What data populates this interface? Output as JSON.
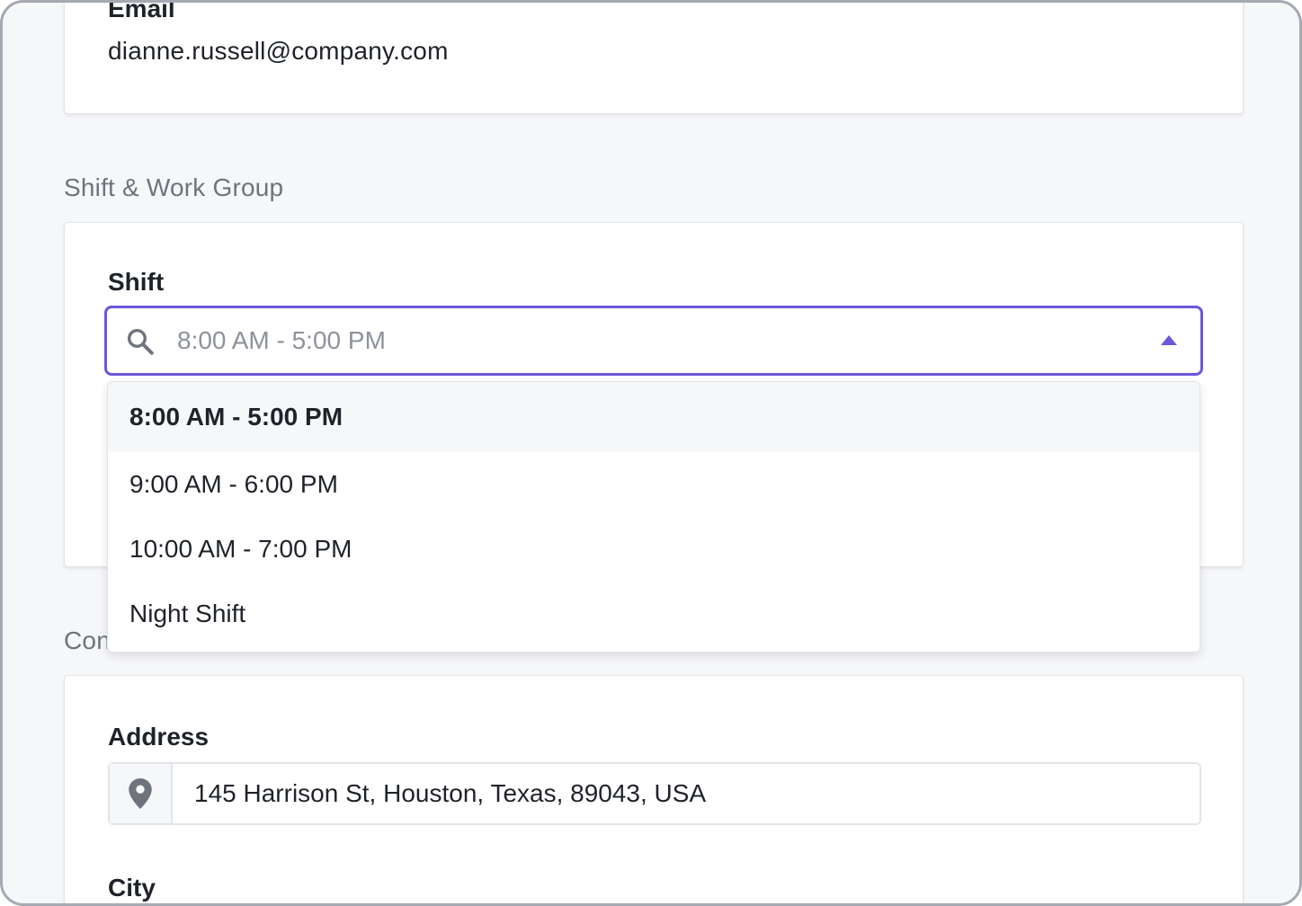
{
  "email": {
    "label": "Email",
    "value": "dianne.russell@company.com"
  },
  "shift_section": {
    "title": "Shift & Work Group",
    "shift": {
      "label": "Shift",
      "placeholder": "8:00 AM - 5:00 PM",
      "options": [
        {
          "label": "8:00 AM - 5:00 PM"
        },
        {
          "label": "9:00 AM - 6:00 PM"
        },
        {
          "label": "10:00 AM - 7:00 PM"
        },
        {
          "label": "Night Shift"
        }
      ],
      "selected_index": 0
    }
  },
  "contact_section": {
    "title": "Con",
    "address": {
      "label": "Address",
      "value": "145 Harrison St, Houston, Texas, 89043, USA"
    },
    "city": {
      "label": "City"
    }
  },
  "colors": {
    "accent": "#6a57d9",
    "page_background": "#f6f7f9",
    "muted_text": "#6e737c",
    "border": "#e2e4e8"
  },
  "icons": {
    "search": "search-icon",
    "caret": "caret-up-icon",
    "location": "location-pin-icon"
  }
}
